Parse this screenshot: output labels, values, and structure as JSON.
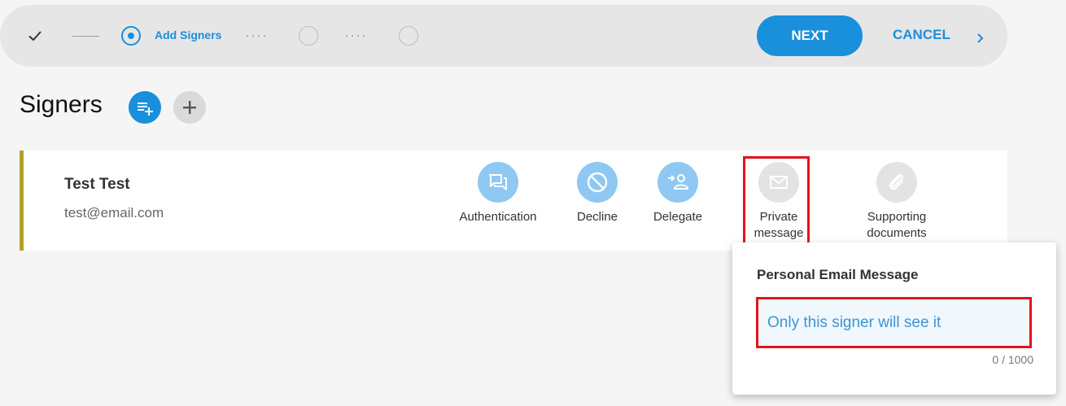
{
  "stepper": {
    "current_step_label": "Add Signers",
    "next_label": "NEXT",
    "cancel_label": "CANCEL"
  },
  "page": {
    "title": "Signers"
  },
  "signer": {
    "name": "Test Test",
    "email": "test@email.com",
    "actions": [
      {
        "label": "Authentication",
        "icon": "forum-icon"
      },
      {
        "label": "Decline",
        "icon": "block-icon"
      },
      {
        "label": "Delegate",
        "icon": "delegate-person-icon"
      },
      {
        "label_line1": "Private",
        "label_line2": "message",
        "icon": "mail-icon"
      },
      {
        "label_line1": "Supporting",
        "label_line2": "documents",
        "icon": "paperclip-icon"
      }
    ]
  },
  "popup": {
    "title": "Personal Email Message",
    "placeholder": "Only this signer will see it",
    "value": "",
    "counter": "0 / 1000"
  },
  "colors": {
    "accent": "#1a8fdc",
    "active_icon_bg": "#8fc8f2",
    "inactive_icon_bg": "#e3e3e3",
    "signer_border": "#b3a12a",
    "highlight": "#e3141c"
  }
}
